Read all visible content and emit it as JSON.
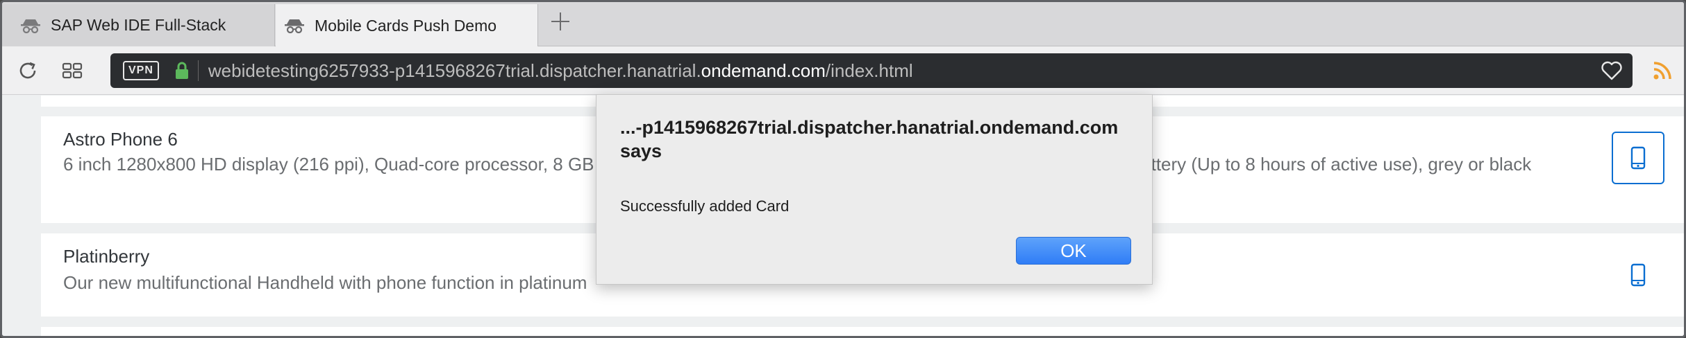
{
  "browser": {
    "tabs": [
      {
        "label": "SAP Web IDE Full-Stack",
        "active": false
      },
      {
        "label": "Mobile Cards Push Demo",
        "active": true
      }
    ],
    "vpn_label": "VPN",
    "url_prefix": "webidetesting6257933-p1415968267trial.dispatcher.hanatrial.",
    "url_domain": "ondemand.com",
    "url_path": "/index.html"
  },
  "products": [
    {
      "title": "Astro Phone 6",
      "description": "6 inch 1280x800 HD display (216 ppi), Quad-core processor, 8 GB internal storage (actual formatted capacity will be less), 3000 mAh battery (Up to 8 hours of active use), grey or black"
    },
    {
      "title": "Platinberry",
      "description": "Our new multifunctional Handheld with phone function in platinum"
    }
  ],
  "dialog": {
    "title": "...-p1415968267trial.dispatcher.hanatrial.ondemand.com says",
    "message": "Successfully added Card",
    "ok_label": "OK"
  },
  "colors": {
    "accent": "#0a6ed1",
    "ok_button": "#3a86f7",
    "url_bar": "#2b2d30",
    "lock": "#5cb85c",
    "rss": "#f0a030"
  }
}
